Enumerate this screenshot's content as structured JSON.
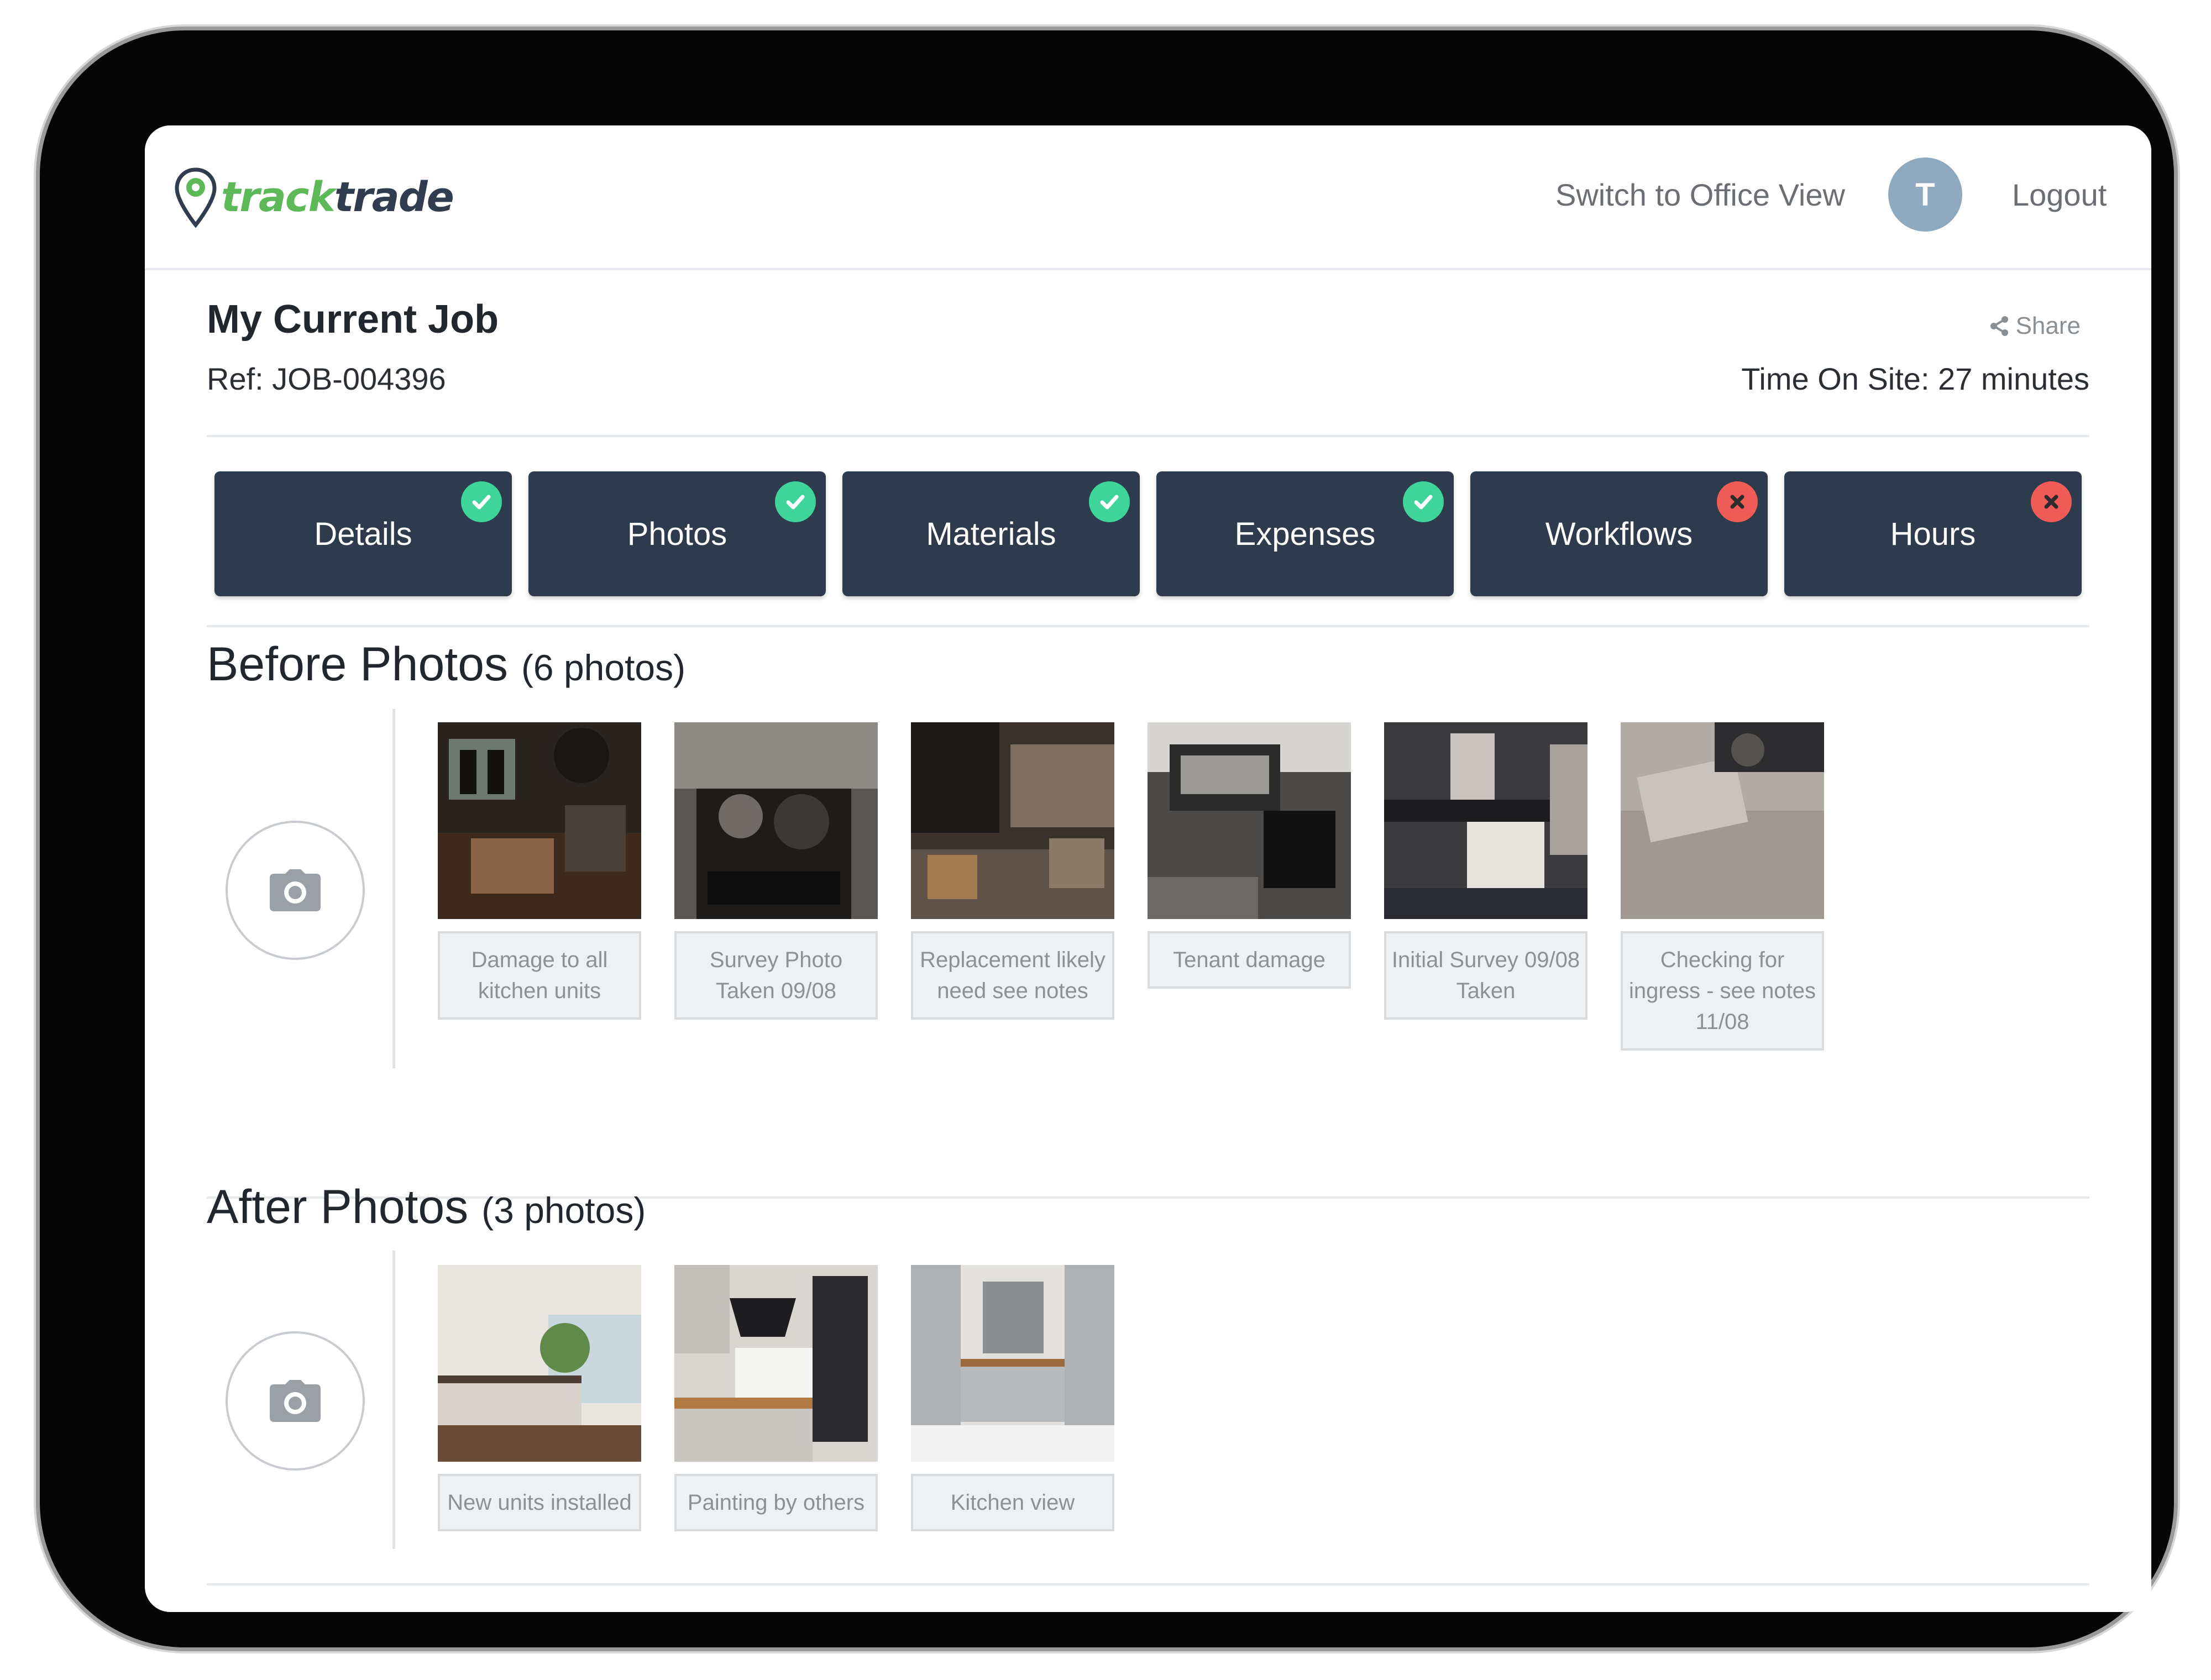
{
  "header": {
    "logo": {
      "part1": "track",
      "part2": "trade"
    },
    "switch_view_label": "Switch to Office View",
    "avatar_initial": "T",
    "logout_label": "Logout"
  },
  "job": {
    "title": "My Current Job",
    "ref": "Ref: JOB-004396",
    "share_label": "Share",
    "time_on_site": "Time On Site: 27 minutes"
  },
  "tabs": [
    {
      "label": "Details",
      "status": "complete"
    },
    {
      "label": "Photos",
      "status": "complete"
    },
    {
      "label": "Materials",
      "status": "complete"
    },
    {
      "label": "Expenses",
      "status": "complete"
    },
    {
      "label": "Workflows",
      "status": "incomplete"
    },
    {
      "label": "Hours",
      "status": "incomplete"
    }
  ],
  "before": {
    "title": "Before Photos",
    "count": "(6 photos)",
    "photos": [
      {
        "caption": "Damage to all kitchen units"
      },
      {
        "caption": "Survey Photo Taken 09/08"
      },
      {
        "caption": "Replacement likely need see notes"
      },
      {
        "caption": "Tenant damage"
      },
      {
        "caption": "Initial Survey 09/08 Taken"
      },
      {
        "caption": "Checking for ingress - see notes 11/08"
      }
    ]
  },
  "after": {
    "title": "After Photos",
    "count": "(3 photos)",
    "photos": [
      {
        "caption": "New units installed"
      },
      {
        "caption": "Painting by others"
      },
      {
        "caption": "Kitchen view"
      }
    ]
  },
  "colors": {
    "brand_green": "#5db957",
    "tab_bg": "#2d3b4c",
    "status_ok": "#3fd49a",
    "status_error": "#ef5b57"
  }
}
